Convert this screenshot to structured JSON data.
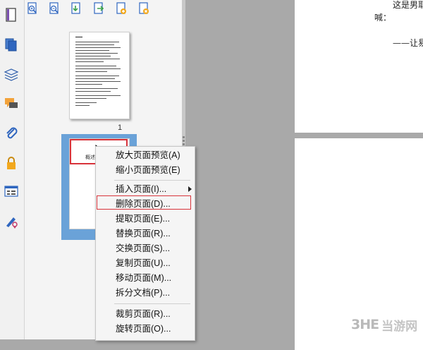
{
  "left_rail": {
    "icons": [
      "page-view-icon",
      "pages-icon",
      "layers-icon",
      "comments-icon",
      "attachments-icon",
      "security-icon",
      "form-icon",
      "signature-icon"
    ]
  },
  "thumb_toolbar": {
    "icons": [
      "zoom-in-thumbnail-icon",
      "zoom-out-thumbnail-icon",
      "insert-page-icon",
      "extract-page-icon",
      "add-page-icon",
      "delete-page-icon"
    ]
  },
  "thumbnails": {
    "page1_number": "1",
    "page2_label": "概述"
  },
  "document": {
    "line1": "这是男耶",
    "line2": "喊：",
    "line3": "——让易"
  },
  "context_menu": {
    "items": [
      {
        "label": "放大页面预览(A)"
      },
      {
        "label": "缩小页面预览(E)"
      },
      {
        "label": "插入页面(I)..."
      },
      {
        "label": "删除页面(D)..."
      },
      {
        "label": "提取页面(E)..."
      },
      {
        "label": "替换页面(R)..."
      },
      {
        "label": "交换页面(S)..."
      },
      {
        "label": "复制页面(U)..."
      },
      {
        "label": "移动页面(M)..."
      },
      {
        "label": "拆分文档(P)..."
      },
      {
        "label": "裁剪页面(R)..."
      },
      {
        "label": "旋转页面(O)..."
      }
    ],
    "highlight_color": "#d8333a"
  },
  "watermark": {
    "logo": "3HE",
    "text": "当游网"
  }
}
